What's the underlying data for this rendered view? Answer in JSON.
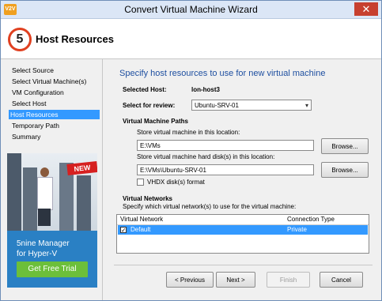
{
  "window": {
    "title": "Convert Virtual Machine Wizard",
    "app_icon": "V2V",
    "close_glyph": "✕"
  },
  "header": {
    "step_number": "5",
    "step_title": "Host Resources"
  },
  "sidebar": {
    "items": [
      {
        "label": "Select Source",
        "active": false
      },
      {
        "label": "Select Virtual Machine(s)",
        "active": false
      },
      {
        "label": "VM Configuration",
        "active": false
      },
      {
        "label": "Select Host",
        "active": false
      },
      {
        "label": "Host Resources",
        "active": true
      },
      {
        "label": "Temporary Path",
        "active": false
      },
      {
        "label": "Summary",
        "active": false
      }
    ]
  },
  "promo": {
    "badge": "NEW",
    "line1": "5nine Manager",
    "line2": "for Hyper-V",
    "cta": "Get Free Trial"
  },
  "main": {
    "heading": "Specify host resources to use for new virtual machine",
    "selected_host_label": "Selected Host:",
    "selected_host_value": "lon-host3",
    "select_review_label": "Select for review:",
    "select_review_value": "Ubuntu-SRV-01",
    "vm_paths_heading": "Virtual Machine Paths",
    "store_vm_label": "Store virtual machine in this location:",
    "store_vm_value": "E:\\VMs",
    "store_disk_label": "Store virtual machine hard disk(s) in this location:",
    "store_disk_value": "E:\\VMs\\Ubuntu-SRV-01",
    "browse_label": "Browse...",
    "vhdx_label": "VHDX disk(s) format",
    "vhdx_checked": false,
    "networks_heading": "Virtual Networks",
    "networks_sub": "Specify which virtual network(s) to use for the virtual machine:",
    "networks_columns": [
      "Virtual Network",
      "Connection Type"
    ],
    "networks_rows": [
      {
        "checked": true,
        "network": "Default",
        "type": "Private"
      }
    ]
  },
  "footer": {
    "previous": "< Previous",
    "next": "Next >",
    "finish": "Finish",
    "cancel": "Cancel"
  },
  "colors": {
    "accent": "#3399ff",
    "heading": "#1e4fa0",
    "close": "#c7402f",
    "promo_bg": "#2a80c4",
    "cta": "#6cbf3a",
    "new_badge": "#d62020"
  }
}
